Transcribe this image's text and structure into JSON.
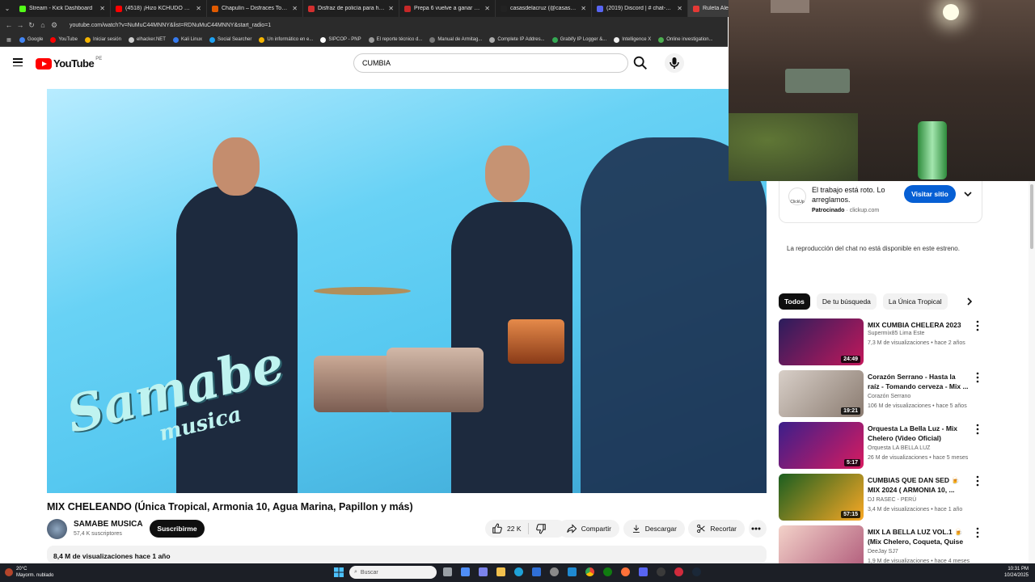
{
  "browser": {
    "tabs": [
      {
        "title": "Stream - Kick Dashboard",
        "color": "#53fc18"
      },
      {
        "title": "(4518) ¡Hizo KCHUDO a un",
        "color": "#ff0000"
      },
      {
        "title": "Chapulín – Disfraces Todo Disfr",
        "color": "#e05a00"
      },
      {
        "title": "Disfraz de policía para hombre",
        "color": "#d32f2f"
      },
      {
        "title": "Prepa 6 vuelve a ganar el Intern",
        "color": "#c62828"
      },
      {
        "title": "casasdelacruz (@casas_el_rey.2",
        "color": "#222222"
      },
      {
        "title": "(2019) Discord | # chat-gene",
        "color": "#5865f2"
      },
      {
        "title": "Ruleta Aleat",
        "color": "#e53935"
      }
    ],
    "url": "youtube.com/watch?v=NuMuC44MNNY&list=RDNuMuC44MNNY&start_radio=1",
    "bookmarks": [
      {
        "label": "Google",
        "color": "#4285f4"
      },
      {
        "label": "YouTube",
        "color": "#ff0000"
      },
      {
        "label": "Iniciar sesión",
        "color": "#f4b400"
      },
      {
        "label": "elhacker.NET",
        "color": "#cccccc"
      },
      {
        "label": "Kali Linux",
        "color": "#367bf0"
      },
      {
        "label": "Social Searcher",
        "color": "#1da1f2"
      },
      {
        "label": "Un informático en e...",
        "color": "#f4b400"
      },
      {
        "label": "SIPCOP - PNP",
        "color": "#ffffff"
      },
      {
        "label": "El reporte técnico d...",
        "color": "#999999"
      },
      {
        "label": "Manual de Armitag...",
        "color": "#777777"
      },
      {
        "label": "Complete IP Addres...",
        "color": "#aaaaaa"
      },
      {
        "label": "Grabify IP Logger &...",
        "color": "#34a853"
      },
      {
        "label": "Intelligence X",
        "color": "#eeeeee"
      },
      {
        "label": "Online investigation...",
        "color": "#4caf50"
      }
    ]
  },
  "header": {
    "logo_text": "YouTube",
    "country": "PE",
    "search_value": "CUMBIA"
  },
  "video": {
    "overlay_logo": "Samabe",
    "overlay_sub": "musica",
    "title": "MIX CHELEANDO (Única Tropical, Armonia 10, Agua Marina, Papillon y más)",
    "channel": "SAMABE MUSICA",
    "subscribers": "57,4 K suscriptores",
    "subscribe_label": "Suscribirme",
    "likes": "22 K",
    "share_label": "Compartir",
    "download_label": "Descargar",
    "clip_label": "Recortar",
    "views_line": "8,4 M de visualizaciones  hace 1 año"
  },
  "sidebar": {
    "ad": {
      "logo": "ClickUp",
      "text": "El trabajo está roto. Lo arreglamos.",
      "sponsored": "Patrocinado",
      "domain": "clickup.com",
      "button": "Visitar sitio"
    },
    "chat_message": "La reproducción del chat no está disponible en este estreno.",
    "chips": [
      "Todos",
      "De tu búsqueda",
      "La Única Tropical"
    ],
    "recommendations": [
      {
        "title": "MIX CUMBIA CHELERA 2023",
        "channel": "Supermix85 Lima Este",
        "meta": "7,3 M de visualizaciones • hace 2 años",
        "duration": "24:49",
        "colors": [
          "#2a1d5c",
          "#c2185b"
        ]
      },
      {
        "title": "Corazón Serrano - Hasta la raíz - Tomando cerveza - Mix ...",
        "channel": "Corazón Serrano",
        "meta": "106 M de visualizaciones • hace 5 años",
        "duration": "19:21",
        "colors": [
          "#d8cfc8",
          "#8a7b70"
        ]
      },
      {
        "title": "Orquesta La Bella Luz - Mix Chelero (Video Oficial)",
        "channel": "Orquesta LA BELLA LUZ",
        "meta": "26 M de visualizaciones • hace 5 meses",
        "duration": "5:17",
        "colors": [
          "#3b1e8a",
          "#d81b60"
        ]
      },
      {
        "title": "CUMBIAS QUE DAN SED 🍺 MIX 2024 (  ARMONIA 10, ...",
        "channel": "DJ RASEC - PERÚ",
        "meta": "3,4 M de visualizaciones • hace 1 año",
        "duration": "57:15",
        "colors": [
          "#1b5e20",
          "#f9a825"
        ]
      },
      {
        "title": "MIX LA BELLA LUZ VOL.1 🍺 (Mix Chelero, Coqueta, Quise ...",
        "channel": "DeeJay SJ7",
        "meta": "1,9 M de visualizaciones • hace 4 meses",
        "duration": "",
        "colors": [
          "#f3d2c9",
          "#b05a7a"
        ]
      }
    ]
  },
  "taskbar": {
    "temp": "20°C",
    "weather": "Mayorm. nublado",
    "search": "Buscar",
    "time": "10:31 PM",
    "date": "10/24/2025"
  }
}
